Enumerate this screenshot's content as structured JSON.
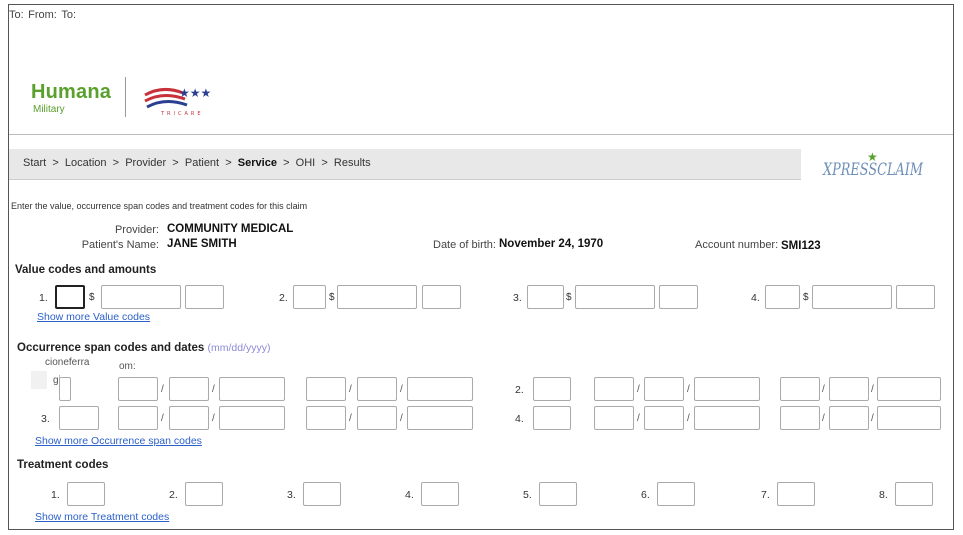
{
  "brand": {
    "name": "Humana",
    "sub": "Military",
    "partner": "TRICARE"
  },
  "breadcrumb": {
    "items": [
      "Start",
      "Location",
      "Provider",
      "Patient",
      "Service",
      "OHI",
      "Results"
    ],
    "current": "Service",
    "sep": ">"
  },
  "product_logo": "XPRESSCLAIM",
  "instructions": "Enter the value, occurrence span codes and treatment codes for this claim",
  "claim": {
    "provider_label": "Provider:",
    "provider": "COMMUNITY MEDICAL",
    "patient_label": "Patient's Name:",
    "patient": "JANE SMITH",
    "dob_label": "Date of birth:",
    "dob": "November 24, 1970",
    "account_label": "Account number:",
    "account": "SMI123"
  },
  "value_codes": {
    "title": "Value codes and amounts",
    "numbers": [
      "1.",
      "2.",
      "3.",
      "4."
    ],
    "dollar": "$",
    "more": "Show more Value codes"
  },
  "occurrence": {
    "title": "Occurrence span codes and dates",
    "hint": "(mm/dd/yyyy)",
    "from": "From:",
    "to": "To:",
    "garbled_label": "cioneferra",
    "garbled_from": "om:",
    "garbled_row": "gi",
    "numbers": [
      "2.",
      "3.",
      "4."
    ],
    "slash": "/",
    "more": "Show more Occurrence span codes"
  },
  "treatment": {
    "title": "Treatment codes",
    "numbers": [
      "1.",
      "2.",
      "3.",
      "4.",
      "5.",
      "6.",
      "7.",
      "8."
    ],
    "more": "Show more Treatment codes"
  },
  "colors": {
    "brand_green": "#5aa02c",
    "link": "#2b5fc9",
    "hint": "#8a8ad6",
    "tricare_red": "#c8303a",
    "tricare_blue": "#2a3f8f"
  }
}
